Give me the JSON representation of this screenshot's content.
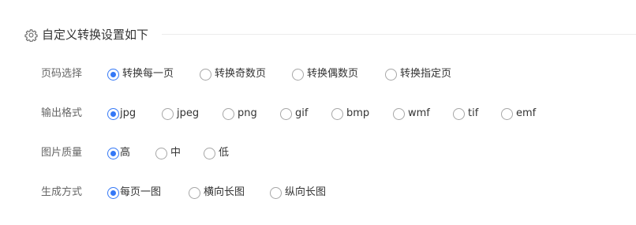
{
  "section": {
    "title": "自定义转换设置如下",
    "icon": "gear-icon"
  },
  "accent_color": "#3478f6",
  "rows": [
    {
      "label": "页码选择",
      "selected": 0,
      "options": [
        "转换每一页",
        "转换奇数页",
        "转换偶数页",
        "转换指定页"
      ]
    },
    {
      "label": "输出格式",
      "selected": 0,
      "options": [
        "jpg",
        "jpeg",
        "png",
        "gif",
        "bmp",
        "wmf",
        "tif",
        "emf"
      ]
    },
    {
      "label": "图片质量",
      "selected": 0,
      "options": [
        "高",
        "中",
        "低"
      ]
    },
    {
      "label": "生成方式",
      "selected": 0,
      "options": [
        "每页一图",
        "横向长图",
        "纵向长图"
      ]
    }
  ]
}
